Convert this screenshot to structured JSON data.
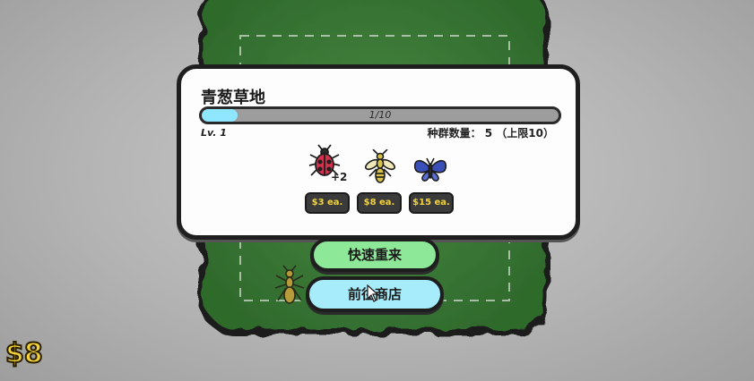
{
  "habitat": {
    "name": "青葱草地",
    "progress_text": "1/10",
    "progress_fraction": 0.1,
    "level": "Lv. 1",
    "population": "种群数量： 5 （上限10）"
  },
  "insects": [
    {
      "icon": "ladybug-icon",
      "color": "#d3324f",
      "extra": "+2",
      "price": "$3 ea."
    },
    {
      "icon": "wasp-icon",
      "color": "#d6c24a",
      "extra": "",
      "price": "$8 ea."
    },
    {
      "icon": "butterfly-icon",
      "color": "#3b4fb8",
      "extra": "",
      "price": "$15 ea."
    }
  ],
  "buttons": {
    "restart": "快速重来",
    "shop": "前往商店"
  },
  "money": "$8",
  "colors": {
    "grass": "#3f7a3a",
    "progress_fill": "#8ee6ff",
    "restart_bg": "#8de898",
    "shop_bg": "#a7ecfb",
    "money": "#f3d23a"
  }
}
